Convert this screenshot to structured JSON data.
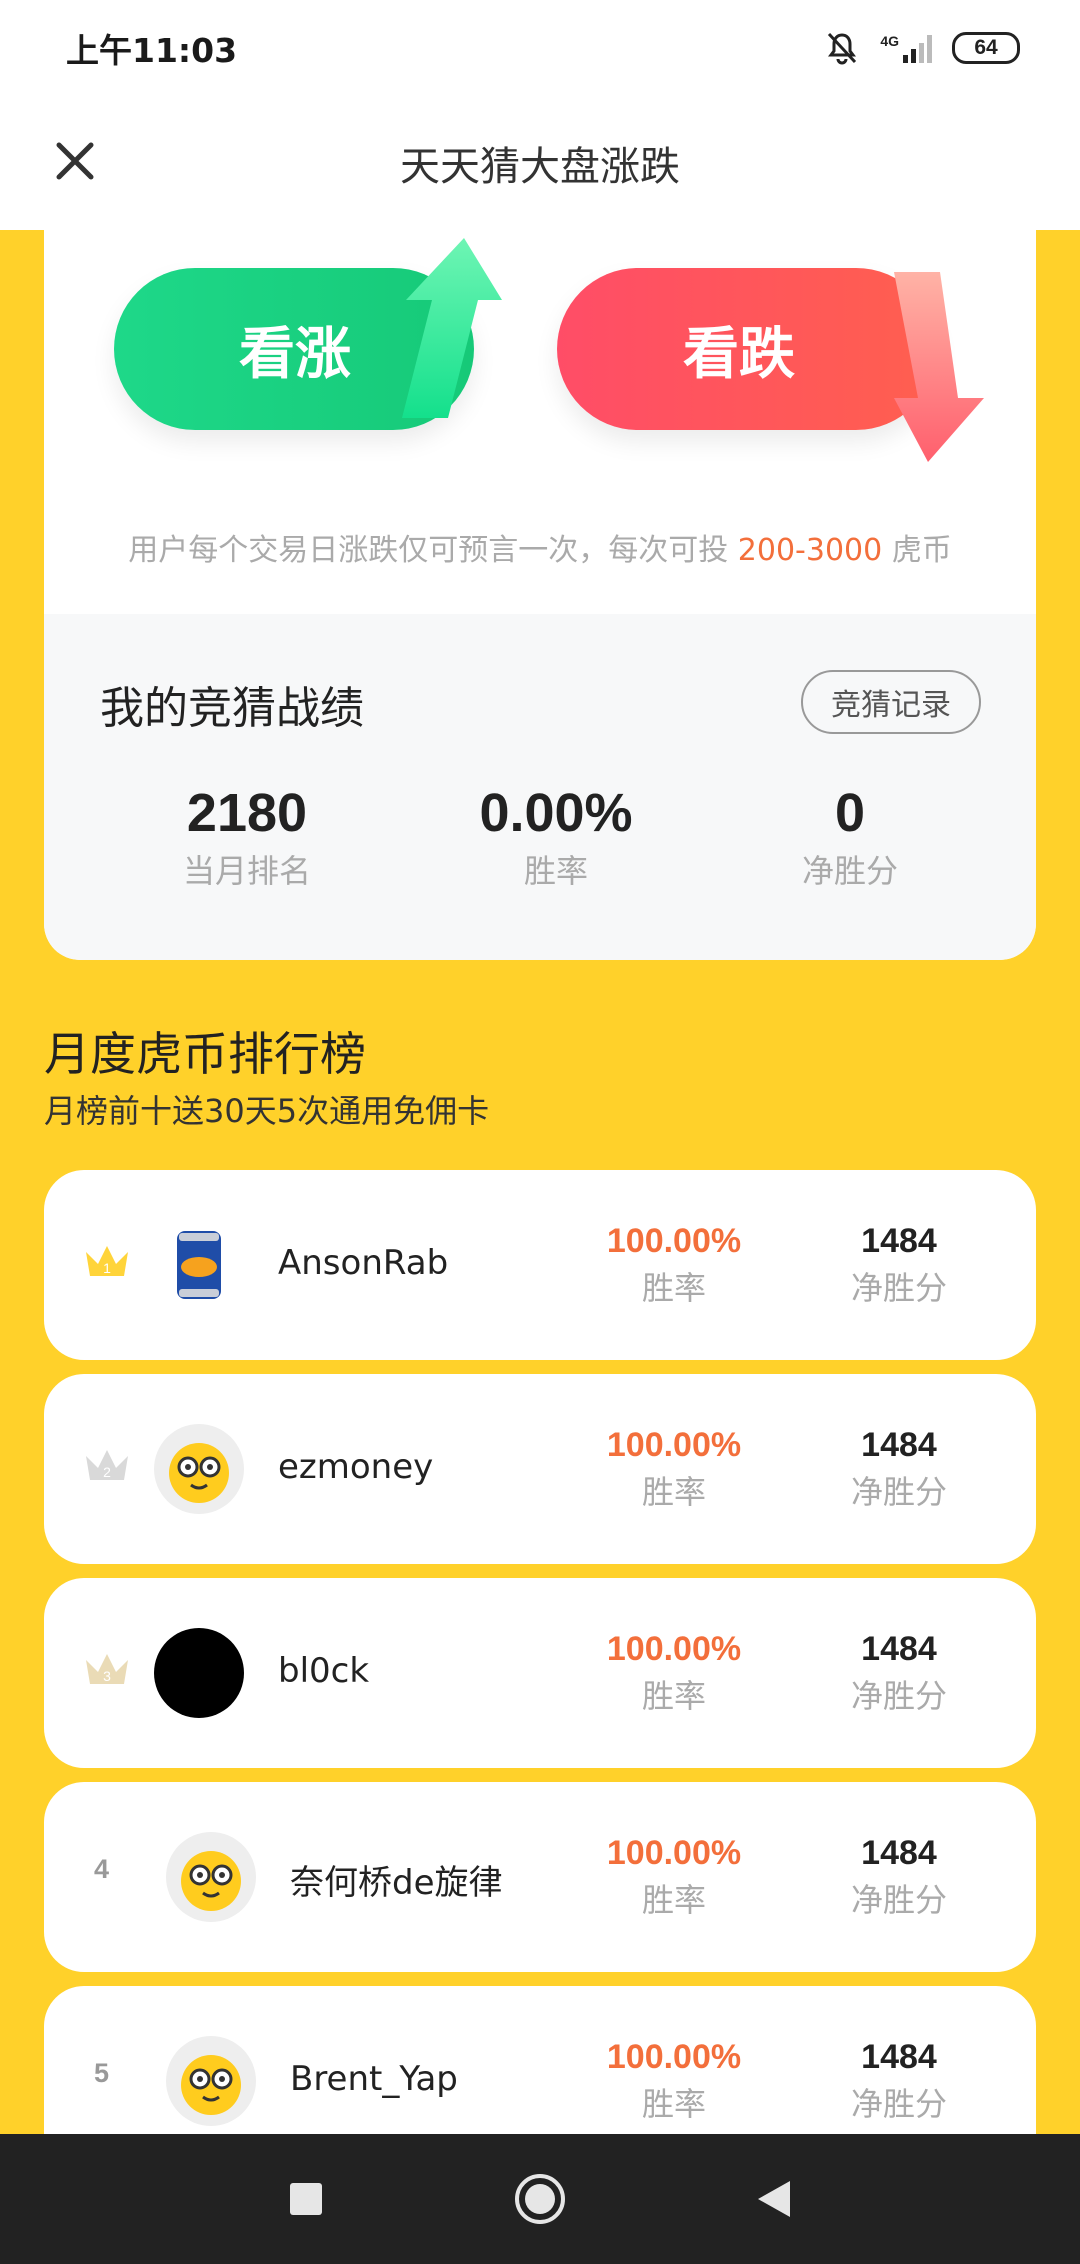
{
  "status_bar": {
    "time": "上午11:03",
    "network": "4G",
    "battery": "64"
  },
  "header": {
    "title": "天天猜大盘涨跌"
  },
  "bet": {
    "up_label": "看涨",
    "down_label": "看跌",
    "note_prefix": "用户每个交易日涨跌仅可预言一次，每次可投 ",
    "note_range": "200-3000",
    "note_suffix": " 虎币"
  },
  "record": {
    "title": "我的竞猜战绩",
    "history_button": "竞猜记录",
    "stats": [
      {
        "value": "2180",
        "label": "当月排名"
      },
      {
        "value": "0.00%",
        "label": "胜率"
      },
      {
        "value": "0",
        "label": "净胜分"
      }
    ]
  },
  "leaderboard": {
    "title": "月度虎币排行榜",
    "subtitle": "月榜前十送30天5次通用免佣卡",
    "entries": [
      {
        "rank": "1",
        "name": "AnsonRab",
        "win_rate": "100.00%",
        "win_rate_label": "胜率",
        "score": "1484",
        "score_label": "净胜分"
      },
      {
        "rank": "2",
        "name": "ezmoney",
        "win_rate": "100.00%",
        "win_rate_label": "胜率",
        "score": "1484",
        "score_label": "净胜分"
      },
      {
        "rank": "3",
        "name": "bl0ck",
        "win_rate": "100.00%",
        "win_rate_label": "胜率",
        "score": "1484",
        "score_label": "净胜分"
      },
      {
        "rank": "4",
        "name": "奈何桥de旋律",
        "win_rate": "100.00%",
        "win_rate_label": "胜率",
        "score": "1484",
        "score_label": "净胜分"
      },
      {
        "rank": "5",
        "name": "Brent_Yap",
        "win_rate": "100.00%",
        "win_rate_label": "胜率",
        "score": "1484",
        "score_label": "净胜分"
      }
    ]
  },
  "colors": {
    "background": "#ffd12a",
    "up": "#1ed889",
    "down": "#ff4d67",
    "accent": "#f36f3b"
  }
}
